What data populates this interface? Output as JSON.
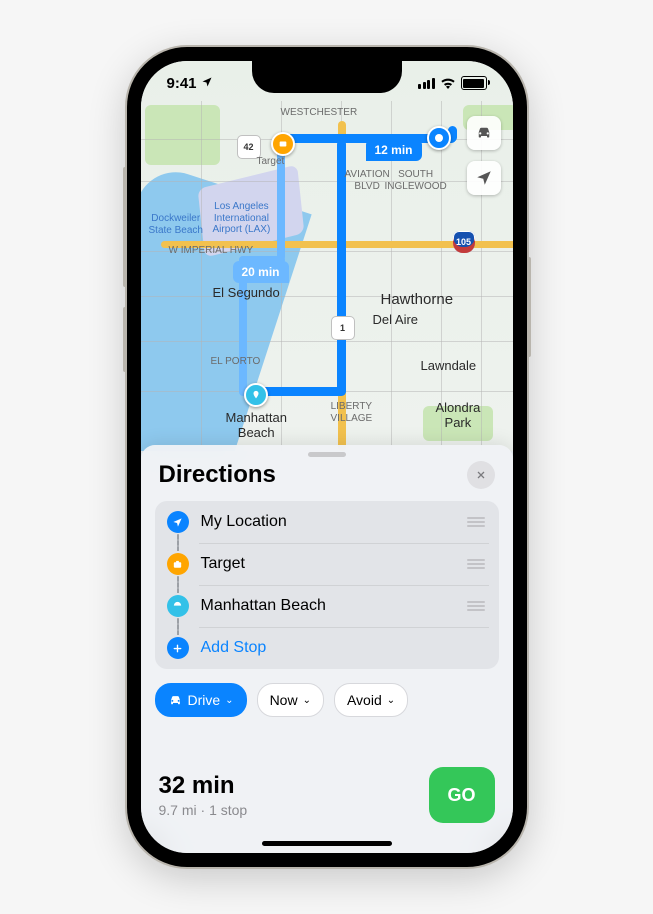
{
  "status": {
    "time": "9:41"
  },
  "map": {
    "labels": {
      "westchester": "WESTCHESTER",
      "south_inglewood": "SOUTH\nINGLEWOOD",
      "aviation_blvd": "AVIATION\nBLVD",
      "dockweiler": "Dockweiler\nState Beach",
      "lax": "Los Angeles\nInternational\nAirport (LAX)",
      "imperial": "W IMPERIAL HWY",
      "el_segundo": "El Segundo",
      "hawthorne": "Hawthorne",
      "del_aire": "Del Aire",
      "el_porto": "EL PORTO",
      "lawndale": "Lawndale",
      "manhattan": "Manhattan\nBeach",
      "liberty": "LIBERTY\nVILLAGE",
      "alondra": "Alondra\nPark",
      "target_pin": "Target"
    },
    "shields": {
      "r42": "42",
      "r1": "1",
      "i105": "105"
    },
    "time_main": "12 min",
    "time_alt": "20 min"
  },
  "sheet": {
    "title": "Directions",
    "stops": {
      "myloc": "My Location",
      "target": "Target",
      "beach": "Manhattan Beach",
      "add": "Add Stop"
    },
    "options": {
      "drive": "Drive",
      "now": "Now",
      "avoid": "Avoid"
    },
    "summary": {
      "time": "32 min",
      "sub": "9.7 mi · 1 stop",
      "go": "GO"
    }
  }
}
